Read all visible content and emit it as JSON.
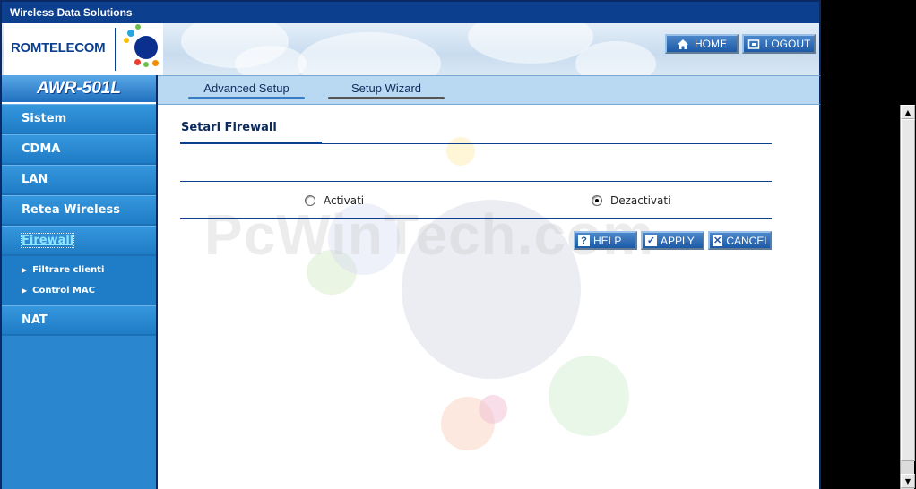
{
  "window": {
    "title": "Wireless Data Solutions"
  },
  "banner": {
    "brand": "ROMTELECOM",
    "home_label": "HOME",
    "logout_label": "LOGOUT"
  },
  "sidebar": {
    "model": "AWR-501L",
    "items": [
      {
        "label": "Sistem"
      },
      {
        "label": "CDMA"
      },
      {
        "label": "LAN"
      },
      {
        "label": "Retea Wireless"
      },
      {
        "label": "Firewall"
      },
      {
        "label": "NAT"
      }
    ],
    "firewall_sub": [
      {
        "label": "Filtrare clienti"
      },
      {
        "label": "Control MAC"
      }
    ]
  },
  "tabs": [
    {
      "label": "Advanced Setup"
    },
    {
      "label": "Setup Wizard"
    }
  ],
  "content": {
    "section_title": "Setari Firewall",
    "options": [
      {
        "label": "Activati",
        "checked": false
      },
      {
        "label": "Dezactivati",
        "checked": true
      }
    ],
    "buttons": {
      "help": "HELP",
      "apply": "APPLY",
      "cancel": "CANCEL"
    },
    "watermark": "PcWinTech.com"
  },
  "colors": {
    "accent": "#0d3f8f",
    "sidebar": "#2a86cf",
    "tabstrip": "#b9d8f2",
    "active_link": "#8fe3ff"
  }
}
